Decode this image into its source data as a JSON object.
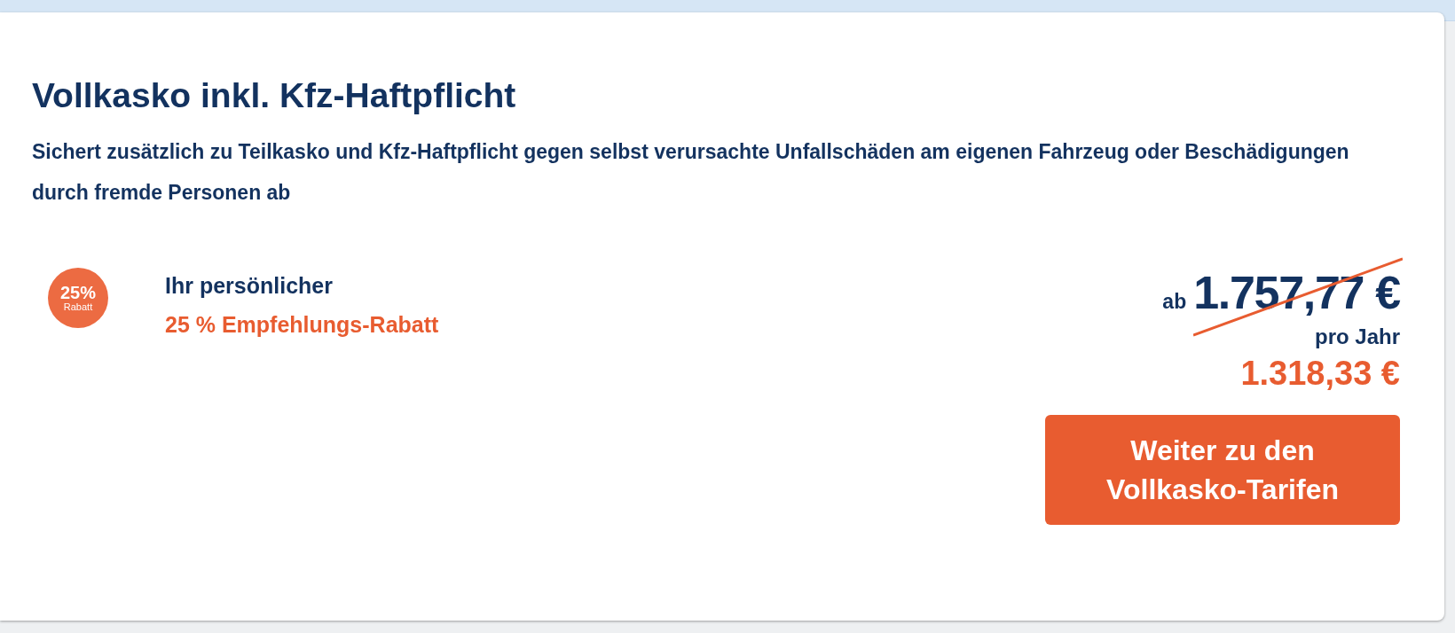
{
  "card": {
    "title": "Vollkasko inkl. Kfz-Haftpflicht",
    "description": "Sichert zusätzlich zu Teilkasko und Kfz-Haftpflicht gegen selbst verursachte Unfallschäden am eigenen Fahrzeug oder Beschädigungen durch fremde Personen ab",
    "badge": {
      "value": "25%",
      "label": "Rabatt"
    },
    "discount": {
      "intro": "Ihr persönlicher",
      "name": "25 % Empfehlungs-Rabatt"
    },
    "price": {
      "prefix": "ab",
      "old": "1.757,77 €",
      "struck": true,
      "period": "pro Jahr",
      "new": "1.318,33 €"
    },
    "button": "Weiter zu den Vollkasko-Tarifen"
  }
}
